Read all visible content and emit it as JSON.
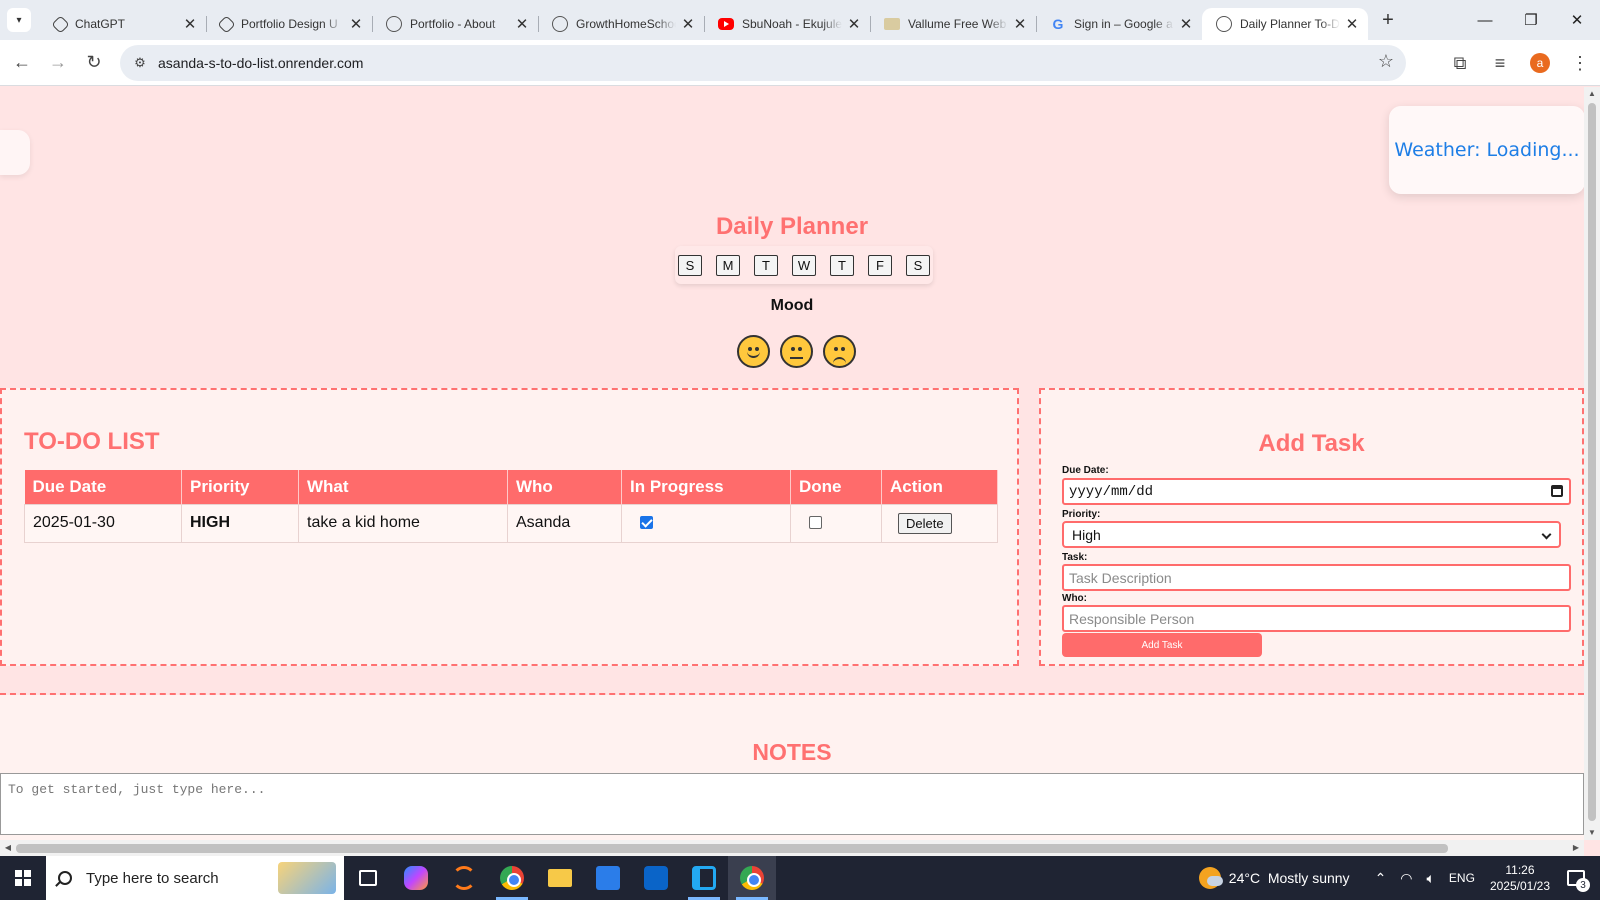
{
  "browser": {
    "tabs": [
      {
        "title": "ChatGPT",
        "icon": "openai-icon"
      },
      {
        "title": "Portfolio Design U",
        "icon": "openai-icon"
      },
      {
        "title": "Portfolio - About",
        "icon": "globe-icon"
      },
      {
        "title": "GrowthHomeSchoo",
        "icon": "globe-icon"
      },
      {
        "title": "SbuNoah - Ekujule",
        "icon": "youtube-icon"
      },
      {
        "title": "Vallume Free Web",
        "icon": "image-icon"
      },
      {
        "title": "Sign in – Google a",
        "icon": "google-icon"
      },
      {
        "title": "Daily Planner To-D",
        "icon": "globe-icon",
        "active": true
      }
    ],
    "url": "asanda-s-to-do-list.onrender.com",
    "profile_initial": "a"
  },
  "page": {
    "weather": "Weather: Loading...",
    "title": "Daily Planner",
    "days": [
      "S",
      "M",
      "T",
      "W",
      "T",
      "F",
      "S"
    ],
    "mood_label": "Mood",
    "moods": [
      "happy",
      "neutral",
      "sad"
    ],
    "todo": {
      "title": "TO-DO LIST",
      "columns": [
        "Due Date",
        "Priority",
        "What",
        "Who",
        "In Progress",
        "Done",
        "Action"
      ],
      "rows": [
        {
          "due": "2025-01-30",
          "priority": "HIGH",
          "what": "take a kid home",
          "who": "Asanda",
          "in_progress": true,
          "done": false,
          "action": "Delete"
        }
      ]
    },
    "add_task": {
      "title": "Add Task",
      "due_label": "Due Date:",
      "due_placeholder": "yyyy/mm/dd",
      "priority_label": "Priority:",
      "priority_value": "High",
      "task_label": "Task:",
      "task_placeholder": "Task Description",
      "who_label": "Who:",
      "who_placeholder": "Responsible Person",
      "button": "Add Task"
    },
    "notes": {
      "title": "NOTES",
      "placeholder": "To get started, just type here..."
    }
  },
  "taskbar": {
    "search_placeholder": "Type here to search",
    "weather": "24°C  Mostly sunny",
    "language": "ENG",
    "time": "11:26",
    "date": "2025/01/23",
    "notifications": "3"
  },
  "colors": {
    "accent": "#ff6b6b",
    "heading": "#ff7171",
    "page_bg": "#ffe4e4",
    "weather_text": "#1e7ee6",
    "priority_high": "#e32020"
  }
}
